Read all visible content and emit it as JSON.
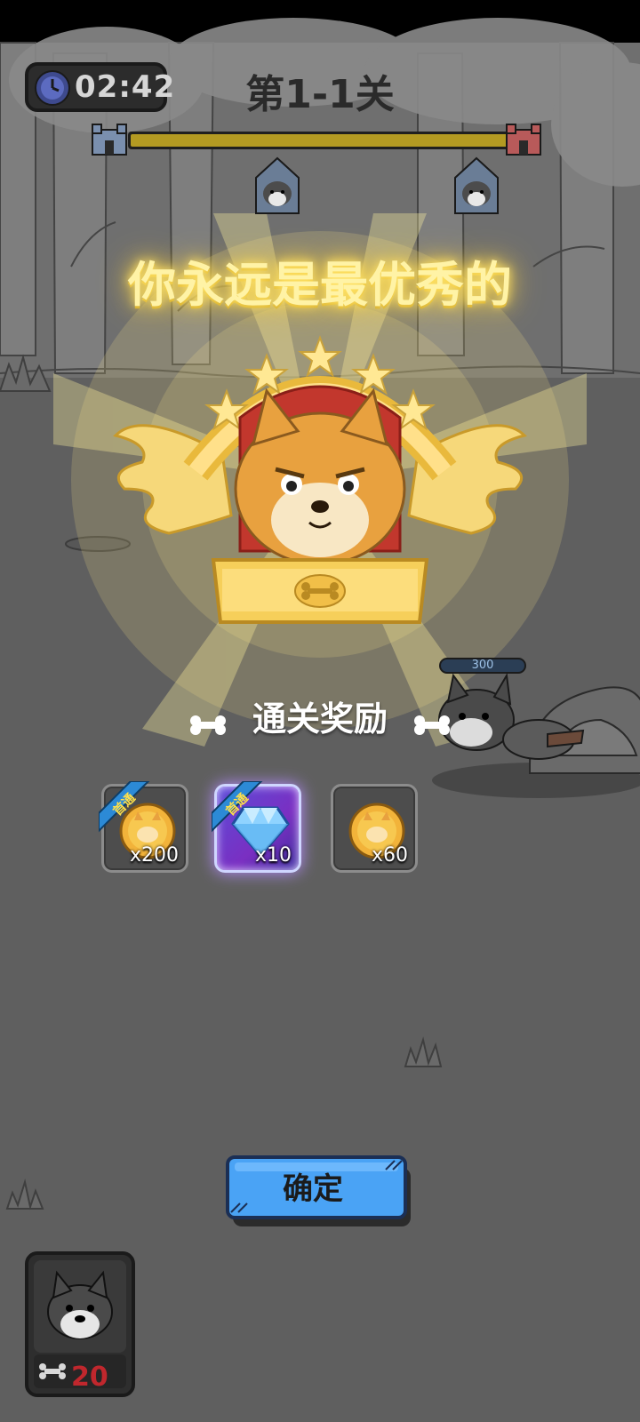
{
  "hud": {
    "timer": "02:42",
    "level_title": "第1-1关",
    "progress": 1.0
  },
  "celebration": {
    "slogan": "你永远是最优秀的"
  },
  "rewards": {
    "title": "通关奖励",
    "items": [
      {
        "icon": "gold-coin-icon",
        "quantity": "x200",
        "first_clear_tag": "首通"
      },
      {
        "icon": "diamond-icon",
        "quantity": "x10",
        "first_clear_tag": "首通"
      },
      {
        "icon": "gold-coin-icon",
        "quantity": "x60"
      }
    ]
  },
  "enemy": {
    "hp": "300"
  },
  "confirm_button": {
    "label": "确定"
  },
  "unit_card": {
    "cost": "20"
  },
  "colors": {
    "progress_fill": "#b39a22",
    "slogan_glow": "#ffe46a",
    "confirm_button": "#4aa3f5",
    "unit_cost": "#c0272d"
  }
}
